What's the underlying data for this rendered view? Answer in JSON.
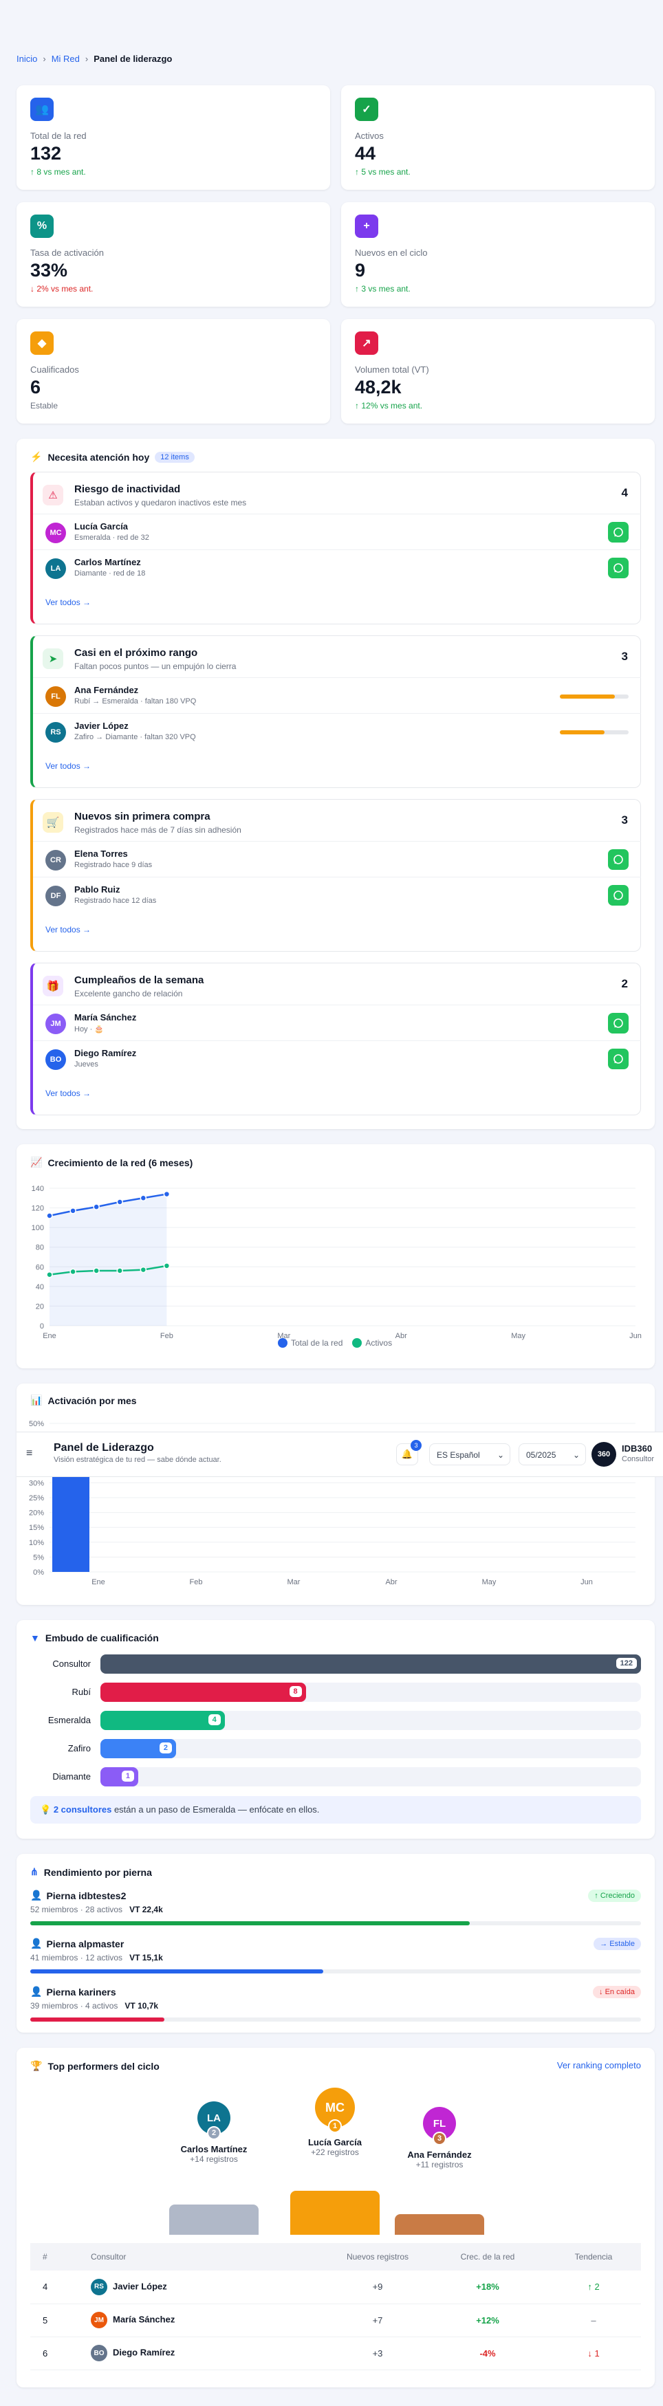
{
  "breadcrumb": {
    "home": "Inicio",
    "network": "Mi Red",
    "current": "Panel de liderazgo"
  },
  "kpis": [
    {
      "label": "Total de la red",
      "value": "132",
      "delta": "8 vs mes ant.",
      "trend": "up",
      "color": "#2563eb",
      "icon": "users-icon"
    },
    {
      "label": "Activos",
      "value": "44",
      "delta": "5 vs mes ant.",
      "trend": "up",
      "color": "#16a34a",
      "icon": "check-circle-icon"
    },
    {
      "label": "Tasa de activación",
      "value": "33%",
      "delta": "2% vs mes ant.",
      "trend": "down",
      "color": "#0d9488",
      "icon": "percent-icon"
    },
    {
      "label": "Nuevos en el ciclo",
      "value": "9",
      "delta": "3 vs mes ant.",
      "trend": "up",
      "color": "#7c3aed",
      "icon": "user-plus-icon"
    },
    {
      "label": "Cualificados",
      "value": "6",
      "delta": "Estable",
      "trend": "flat",
      "color": "#f59e0b",
      "icon": "diamond-icon"
    },
    {
      "label": "Volumen total (VT)",
      "value": "48,2k",
      "delta": "12% vs mes ant.",
      "trend": "up",
      "color": "#e11d48",
      "icon": "chart-icon"
    }
  ],
  "attention": {
    "title": "Necesita atención hoy",
    "badge": "12 items",
    "see_all": "Ver todos →",
    "groups": [
      {
        "title": "Riesgo de inactividad",
        "subtitle": "Estaban activos y quedaron inactivos este mes",
        "count": "4",
        "color": "#e11d48",
        "bg": "#fde8ec",
        "icon": "⚠",
        "rows": [
          {
            "initials": "MC",
            "name": "Lucía García",
            "sub": "Esmeralda · red de 32",
            "avatar": "#c026d3"
          },
          {
            "initials": "LA",
            "name": "Carlos Martínez",
            "sub": "Diamante · red de 18",
            "avatar": "#0e7490"
          }
        ]
      },
      {
        "title": "Casi en el próximo rango",
        "subtitle": "Faltan pocos puntos — un empujón lo cierra",
        "count": "3",
        "color": "#16a34a",
        "bg": "#e7f7ec",
        "icon": "➤",
        "rows": [
          {
            "initials": "FL",
            "name": "Ana Fernández",
            "sub": "Rubí → Esmeralda · faltan 180 VPQ",
            "avatar": "#d97706",
            "progress": 0.8
          },
          {
            "initials": "RS",
            "name": "Javier López",
            "sub": "Zafiro → Diamante · faltan 320 VPQ",
            "avatar": "#0e7490",
            "progress": 0.65
          }
        ]
      },
      {
        "title": "Nuevos sin primera compra",
        "subtitle": "Registrados hace más de 7 días sin adhesión",
        "count": "3",
        "color": "#f59e0b",
        "bg": "#fef3c7",
        "icon": "🛒",
        "rows": [
          {
            "initials": "CR",
            "name": "Elena Torres",
            "sub": "Registrado hace 9 días",
            "avatar": "#64748b"
          },
          {
            "initials": "DF",
            "name": "Pablo Ruiz",
            "sub": "Registrado hace 12 días",
            "avatar": "#64748b"
          }
        ]
      },
      {
        "title": "Cumpleaños de la semana",
        "subtitle": "Excelente gancho de relación",
        "count": "2",
        "color": "#7c3aed",
        "bg": "#f3e8ff",
        "icon": "🎁",
        "rows": [
          {
            "initials": "JM",
            "name": "María Sánchez",
            "sub": "Hoy · 🎂",
            "avatar": "#8b5cf6"
          },
          {
            "initials": "BO",
            "name": "Diego Ramírez",
            "sub": "Jueves",
            "avatar": "#2563eb"
          }
        ]
      }
    ]
  },
  "growth": {
    "title": "Crecimiento de la red (6 meses)",
    "legend": [
      "Total de la red",
      "Activos"
    ],
    "chart_data": {
      "type": "line",
      "categories": [
        "Ene",
        "Feb",
        "Mar",
        "Abr",
        "May",
        "Jun"
      ],
      "series": [
        {
          "name": "Total de la red",
          "color": "#2563eb",
          "x": [
            0,
            0.2,
            0.4,
            0.6,
            0.8,
            1.0
          ],
          "values": [
            112,
            117,
            121,
            126,
            130,
            134
          ]
        },
        {
          "name": "Activos",
          "color": "#10b981",
          "x": [
            0,
            0.2,
            0.4,
            0.6,
            0.8,
            1.0
          ],
          "values": [
            52,
            55,
            56,
            56,
            57,
            61
          ]
        }
      ],
      "ylim": [
        0,
        140
      ],
      "yticks": [
        0,
        20,
        40,
        60,
        80,
        100,
        120,
        140
      ]
    }
  },
  "activation": {
    "title": "Activación por mes",
    "chart_data": {
      "type": "bar",
      "categories": [
        "Ene",
        "Feb",
        "Mar",
        "Abr",
        "May",
        "Jun"
      ],
      "values": [
        40,
        null,
        null,
        null,
        null,
        null
      ],
      "ylim": [
        0,
        50
      ],
      "yticks": [
        "0%",
        "5%",
        "10%",
        "15%",
        "20%",
        "25%",
        "30%",
        "35%",
        "40%",
        "45%",
        "50%"
      ]
    }
  },
  "floating_header": {
    "title": "Panel de Liderazgo",
    "subtitle": "Visión estratégica de tu red — sabe dónde actuar.",
    "notif_count": "3",
    "language": "ES Español",
    "period": "05/2025",
    "user_badge": "360",
    "user_name": "IDB360",
    "user_role": "Consultor"
  },
  "funnel": {
    "title": "Embudo de cualificación",
    "rows": [
      {
        "label": "Consultor",
        "value": 122,
        "color": "#475569"
      },
      {
        "label": "Rubí",
        "value": 8,
        "color": "#e11d48"
      },
      {
        "label": "Esmeralda",
        "value": 4,
        "color": "#10b981"
      },
      {
        "label": "Zafiro",
        "value": 2,
        "color": "#3b82f6"
      },
      {
        "label": "Diamante",
        "value": 1,
        "color": "#8b5cf6"
      }
    ],
    "note_strong": "2 consultores",
    "note_rest": " están a un paso de Esmeralda — enfócate en ellos."
  },
  "legs": {
    "title": "Rendimiento por pierna",
    "items": [
      {
        "name": "Pierna idbtestes2",
        "members": "52 miembros",
        "active": "28 activos",
        "vt": "VT 22,4k",
        "tag": "↑ Creciendo",
        "tag_bg": "#dcfce7",
        "tag_color": "#16a34a",
        "bar": 0.72,
        "bar_color": "#16a34a"
      },
      {
        "name": "Pierna alpmaster",
        "members": "41 miembros",
        "active": "12 activos",
        "vt": "VT 15,1k",
        "tag": "→ Estable",
        "tag_bg": "#e0e7ff",
        "tag_color": "#2563eb",
        "bar": 0.48,
        "bar_color": "#2563eb"
      },
      {
        "name": "Pierna kariners",
        "members": "39 miembros",
        "active": "4 activos",
        "vt": "VT 10,7k",
        "tag": "↓ En caída",
        "tag_bg": "#fee2e2",
        "tag_color": "#dc2626",
        "bar": 0.22,
        "bar_color": "#e11d48"
      }
    ]
  },
  "top": {
    "title": "Top performers del ciclo",
    "link": "Ver ranking completo",
    "podium": [
      {
        "initials": "LA",
        "name": "Carlos Martínez",
        "regs": "+14 registros",
        "rank": "2",
        "avatar": "#0e7490",
        "medal": "#94a3b8"
      },
      {
        "initials": "MC",
        "name": "Lucía García",
        "regs": "+22 registros",
        "rank": "1",
        "avatar": "#f59e0b",
        "medal": "#f59e0b"
      },
      {
        "initials": "FL",
        "name": "Ana Fernández",
        "regs": "+11 registros",
        "rank": "3",
        "avatar": "#c026d3",
        "medal": "#c2703d"
      }
    ],
    "headers": [
      "#",
      "Consultor",
      "Nuevos registros",
      "Crec. de la red",
      "Tendencia"
    ],
    "rows": [
      {
        "pos": "4",
        "initials": "RS",
        "name": "Javier López",
        "regs": "+9",
        "growth": "+18%",
        "trend": "↑ 2",
        "avatar": "#0e7490",
        "gcolor": "#16a34a",
        "tcolor": "#16a34a"
      },
      {
        "pos": "5",
        "initials": "JM",
        "name": "María Sánchez",
        "regs": "+7",
        "growth": "+12%",
        "trend": "–",
        "avatar": "#ea580c",
        "gcolor": "#16a34a",
        "tcolor": "#6b7280"
      },
      {
        "pos": "6",
        "initials": "BO",
        "name": "Diego Ramírez",
        "regs": "+3",
        "growth": "-4%",
        "trend": "↓ 1",
        "avatar": "#64748b",
        "gcolor": "#dc2626",
        "tcolor": "#dc2626"
      }
    ]
  }
}
